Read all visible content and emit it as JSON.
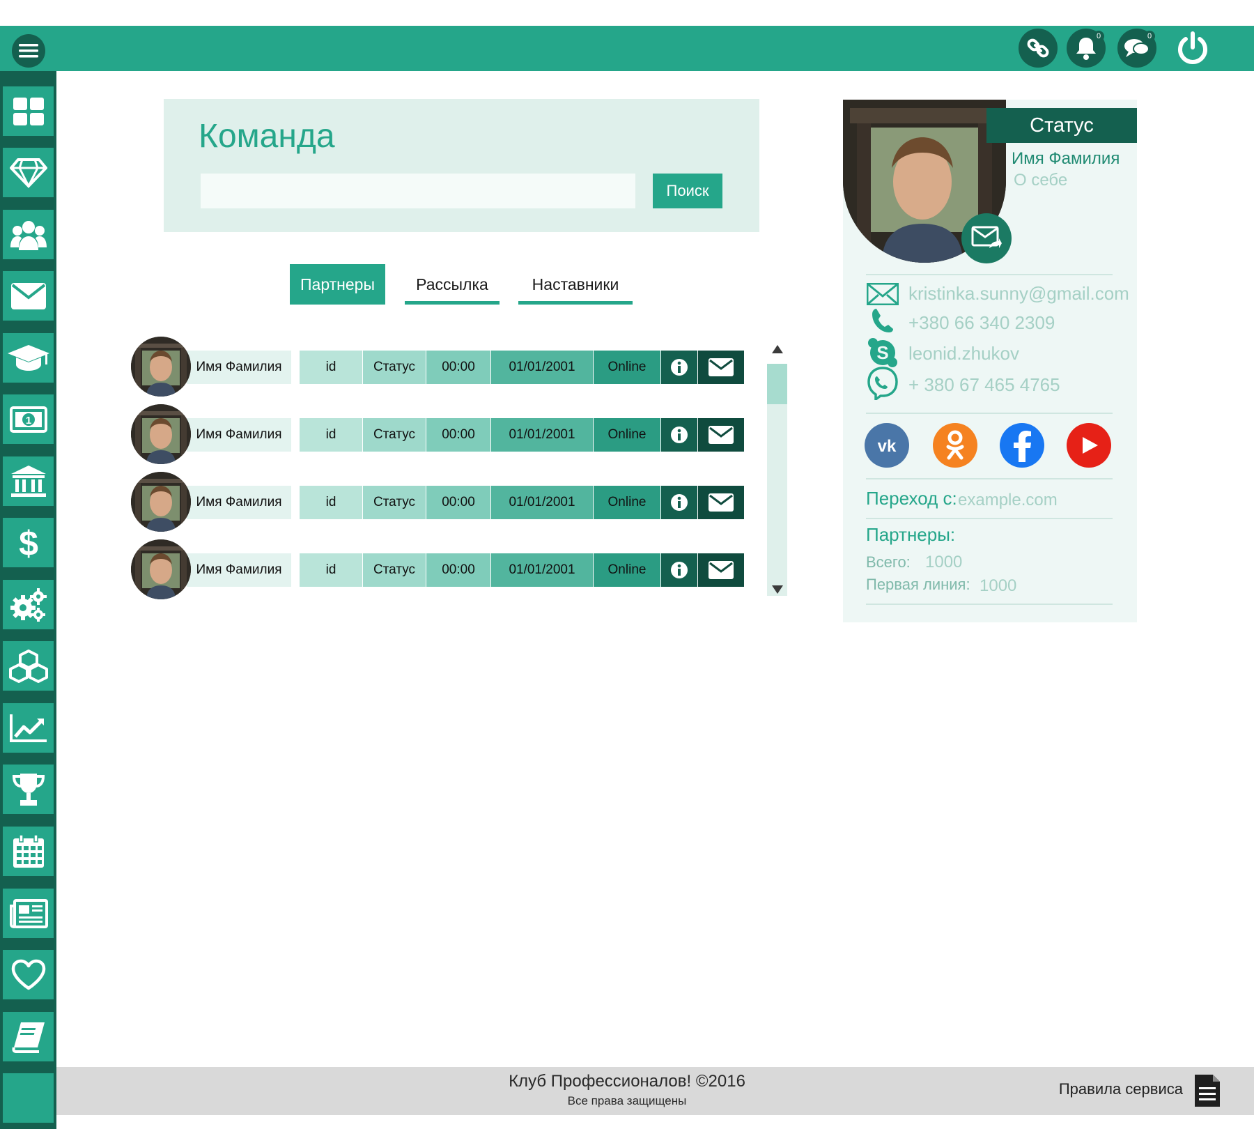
{
  "topbar": {
    "notifications_count": "0",
    "messages_count": "0"
  },
  "icons": {
    "menu": "hamburger-menu-icon",
    "link": "link-icon",
    "bell": "bell-icon",
    "chat": "chat-icon",
    "power": "power-icon"
  },
  "sidebar": {
    "items": [
      {
        "icon": "dashboard-icon"
      },
      {
        "icon": "diamond-icon"
      },
      {
        "icon": "team-icon"
      },
      {
        "icon": "mail-icon"
      },
      {
        "icon": "graduation-cap-icon"
      },
      {
        "icon": "money-icon"
      },
      {
        "icon": "bank-icon"
      },
      {
        "icon": "dollar-icon"
      },
      {
        "icon": "gears-icon"
      },
      {
        "icon": "cubes-icon"
      },
      {
        "icon": "chart-icon"
      },
      {
        "icon": "trophy-icon"
      },
      {
        "icon": "calendar-icon"
      },
      {
        "icon": "news-icon"
      },
      {
        "icon": "heart-icon"
      },
      {
        "icon": "book-icon"
      },
      {
        "icon": ""
      }
    ]
  },
  "main": {
    "title": "Команда",
    "search": {
      "value": "",
      "placeholder": "",
      "button_label": "Поиск"
    },
    "tabs": [
      {
        "label": "Партнеры",
        "active": true
      },
      {
        "label": "Рассылка",
        "active": false
      },
      {
        "label": "Наставники",
        "active": false
      }
    ],
    "rows": [
      {
        "name": "Имя Фамилия",
        "id": "id",
        "status": "Статус",
        "time": "00:00",
        "date": "01/01/2001",
        "online": "Online"
      },
      {
        "name": "Имя Фамилия",
        "id": "id",
        "status": "Статус",
        "time": "00:00",
        "date": "01/01/2001",
        "online": "Online"
      },
      {
        "name": "Имя Фамилия",
        "id": "id",
        "status": "Статус",
        "time": "00:00",
        "date": "01/01/2001",
        "online": "Online"
      },
      {
        "name": "Имя Фамилия",
        "id": "id",
        "status": "Статус",
        "time": "00:00",
        "date": "01/01/2001",
        "online": "Online"
      }
    ]
  },
  "profile": {
    "status": "Статус",
    "name": "Имя Фамилия",
    "about": "О себе",
    "email": "kristinka.sunny@gmail.com",
    "phone": "+380 66 340 2309",
    "skype": "leonid.zhukov",
    "viber": "+ 380 67 465 4765",
    "social": [
      "vk-icon",
      "odnoklassniki-icon",
      "facebook-icon",
      "youtube-icon"
    ],
    "referrer_label": "Переход с:",
    "referrer_value": "example.com",
    "partners_label": "Партнеры:",
    "total_label": "Всего:",
    "total_value": "1000",
    "first_line_label": "Первая линия:",
    "first_line_value": "1000"
  },
  "footer": {
    "title": "Клуб Профессионалов! ©2016",
    "subtitle": "Все права защищены",
    "rules": "Правила сервиса"
  },
  "colors": {
    "primary": "#25a68a",
    "dark": "#14604f",
    "light_bg": "#dff0eb",
    "vk": "#4a76a8",
    "ok": "#f58220",
    "fb": "#1877f2",
    "yt": "#e62117"
  }
}
